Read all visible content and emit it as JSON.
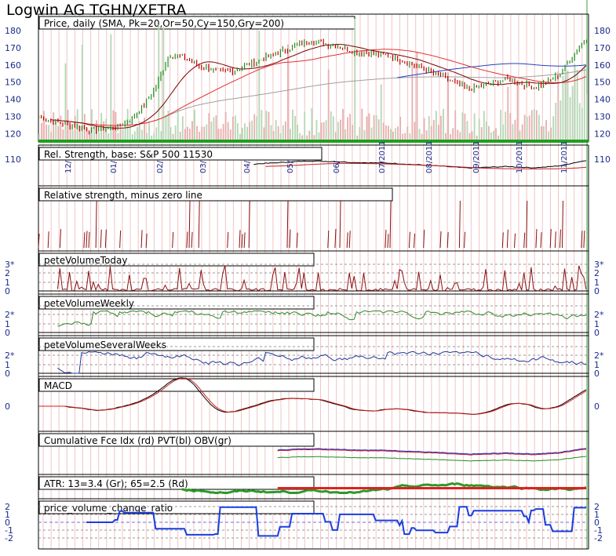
{
  "title": "Logwin AG TGHN/XETRA",
  "panels": [
    {
      "key": "price",
      "label": "Price, daily (SMA, Pk=20,Or=50,Cy=150,Gry=200)",
      "ticks": [
        "180",
        "170",
        "160",
        "150",
        "140",
        "130",
        "120"
      ],
      "ylim": [
        117,
        185
      ]
    },
    {
      "key": "rs",
      "label": "Rel. Strength, base: S&P 500 11530",
      "ticks": [
        "110"
      ],
      "months": [
        "12/",
        "01/",
        "02/",
        "03/",
        "04/",
        "05/",
        "06/",
        "07/2011",
        "08/2011",
        "09/2011",
        "10/2011",
        "11/2011"
      ]
    },
    {
      "key": "rsz",
      "label": "Relative strength, minus zero line",
      "ticks": []
    },
    {
      "key": "pvt",
      "label": "peteVolumeToday",
      "ticks": [
        "3*",
        "2",
        "1",
        "0"
      ]
    },
    {
      "key": "pvw",
      "label": "peteVolumeWeekly",
      "ticks": [
        "2*",
        "1",
        "0"
      ]
    },
    {
      "key": "pvs",
      "label": "peteVolumeSeveralWeeks",
      "ticks": [
        "2*",
        "1",
        "0"
      ]
    },
    {
      "key": "macd",
      "label": "MACD",
      "ticks": [
        "0"
      ]
    },
    {
      "key": "cfi",
      "label": "Cumulative Fce Idx (rd) PVT(bl) OBV(gr)",
      "ticks": []
    },
    {
      "key": "atr",
      "label": "ATR: 13=3.4 (Gr); 65=2.5 (Rd)",
      "ticks": []
    },
    {
      "key": "pvcr",
      "label": "price_volume_change_ratio",
      "ticks": [
        "2",
        "1",
        "0",
        "-1",
        "-2"
      ]
    }
  ],
  "chart_data": {
    "type": "line",
    "title": "Logwin AG TGHN/XETRA",
    "subtitle": "Price, daily (SMA, Pk=20,Or=50,Cy=150,Gry=200)",
    "x": [
      "12/",
      "01/",
      "02/",
      "03/",
      "04/",
      "05/",
      "06/",
      "07/2011",
      "08/2011",
      "09/2011",
      "10/2011",
      "11/2011"
    ],
    "ylim": [
      117,
      185
    ],
    "series": [
      {
        "values": [
          130,
          127,
          126,
          124,
          122,
          123,
          124,
          128,
          136,
          148,
          166,
          165,
          160,
          158,
          156,
          157,
          160,
          163,
          166,
          169,
          172,
          174,
          172,
          171,
          168,
          167,
          166,
          165,
          162,
          159,
          156,
          153,
          149,
          146,
          148,
          150,
          152,
          149,
          147,
          150,
          155,
          166,
          176
        ]
      }
    ],
    "colors": {
      "up": "#1e8f1e",
      "down": "#c00000",
      "sma20": "#7a0000",
      "sma50": "#e03030",
      "sma150": "#2040c0",
      "sma200": "#a0a0a0",
      "rsz": "#8b1010",
      "pvw": "#2a8a2a",
      "pvs": "#1f3a9a",
      "atr13": "#2a9a2a",
      "atr65": "#e02020",
      "pvcr": "#1a3ee0"
    }
  }
}
